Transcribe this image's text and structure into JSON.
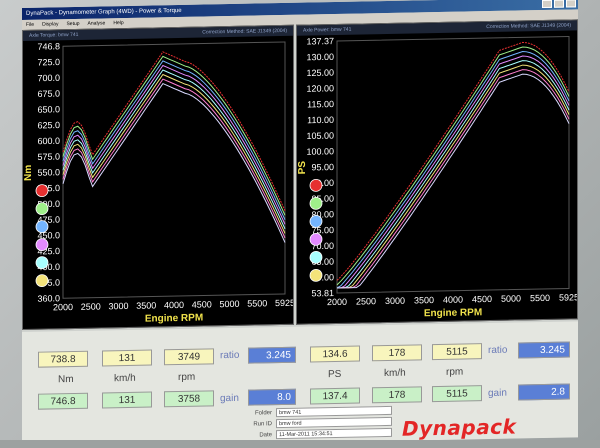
{
  "window": {
    "title": "DynaPack - Dynamometer Graph (4WD) - Power & Torque"
  },
  "menu": [
    "File",
    "Display",
    "Setup",
    "Analyse",
    "Help"
  ],
  "torque_panel": {
    "header_left": "Axle Torque: bmw 741",
    "header_right": "Correction Method: SAE J1349 (2004)",
    "y_label": "Nm",
    "x_label": "Engine RPM",
    "y_ticks": [
      "746.8",
      "725.0",
      "700.0",
      "675.0",
      "650.0",
      "625.0",
      "600.0",
      "575.0",
      "550.0",
      "525.0",
      "500.0",
      "475.0",
      "450.0",
      "425.0",
      "400.0",
      "375.0",
      "360.0"
    ],
    "x_ticks": [
      "2000",
      "2500",
      "3000",
      "3500",
      "4000",
      "4500",
      "5000",
      "5500",
      "5925"
    ]
  },
  "power_panel": {
    "header_left": "Axle Power: bmw 741",
    "header_right": "Correction Method: SAE J1349 (2004)",
    "y_label": "PS",
    "x_label": "Engine RPM",
    "y_ticks": [
      "137.37",
      "130.00",
      "125.00",
      "120.00",
      "115.00",
      "110.00",
      "105.00",
      "100.00",
      "95.00",
      "90.00",
      "85.00",
      "80.00",
      "75.00",
      "70.00",
      "65.00",
      "60.00",
      "53.81"
    ],
    "x_ticks": [
      "2000",
      "2500",
      "3000",
      "3500",
      "4000",
      "4500",
      "5000",
      "5500",
      "5925"
    ]
  },
  "series_colors": [
    "#e63030",
    "#9fef8a",
    "#74b5ff",
    "#e38aff",
    "#a8ffff",
    "#f3e37a",
    "#ff7fd0",
    "#d9d9ff"
  ],
  "readouts": {
    "left": {
      "row1": {
        "torque": "738.8",
        "speed": "131",
        "rpm": "3749"
      },
      "labels": {
        "unit1": "Nm",
        "unit2": "km/h",
        "unit3": "rpm"
      },
      "row2": {
        "torque": "746.8",
        "speed": "131",
        "rpm": "3758"
      }
    },
    "right": {
      "row1": {
        "power": "134.6",
        "speed": "178",
        "rpm": "5115"
      },
      "labels": {
        "unit1": "PS",
        "unit2": "km/h",
        "unit3": "rpm"
      },
      "row2": {
        "power": "137.4",
        "speed": "178",
        "rpm": "5115"
      }
    },
    "ratio_label": "ratio",
    "gain_label": "gain",
    "left_ratio": "3.245",
    "left_gain": "8.0",
    "right_ratio": "3.245",
    "right_gain": "2.8"
  },
  "footer": {
    "folder_label": "Folder",
    "folder_value": "bmw 741",
    "runid_label": "Run ID",
    "runid_value": "bmw ford",
    "date_label": "Date",
    "date_value": "11-Mar-2011 15:34:51"
  },
  "brand": "Dynapack"
}
